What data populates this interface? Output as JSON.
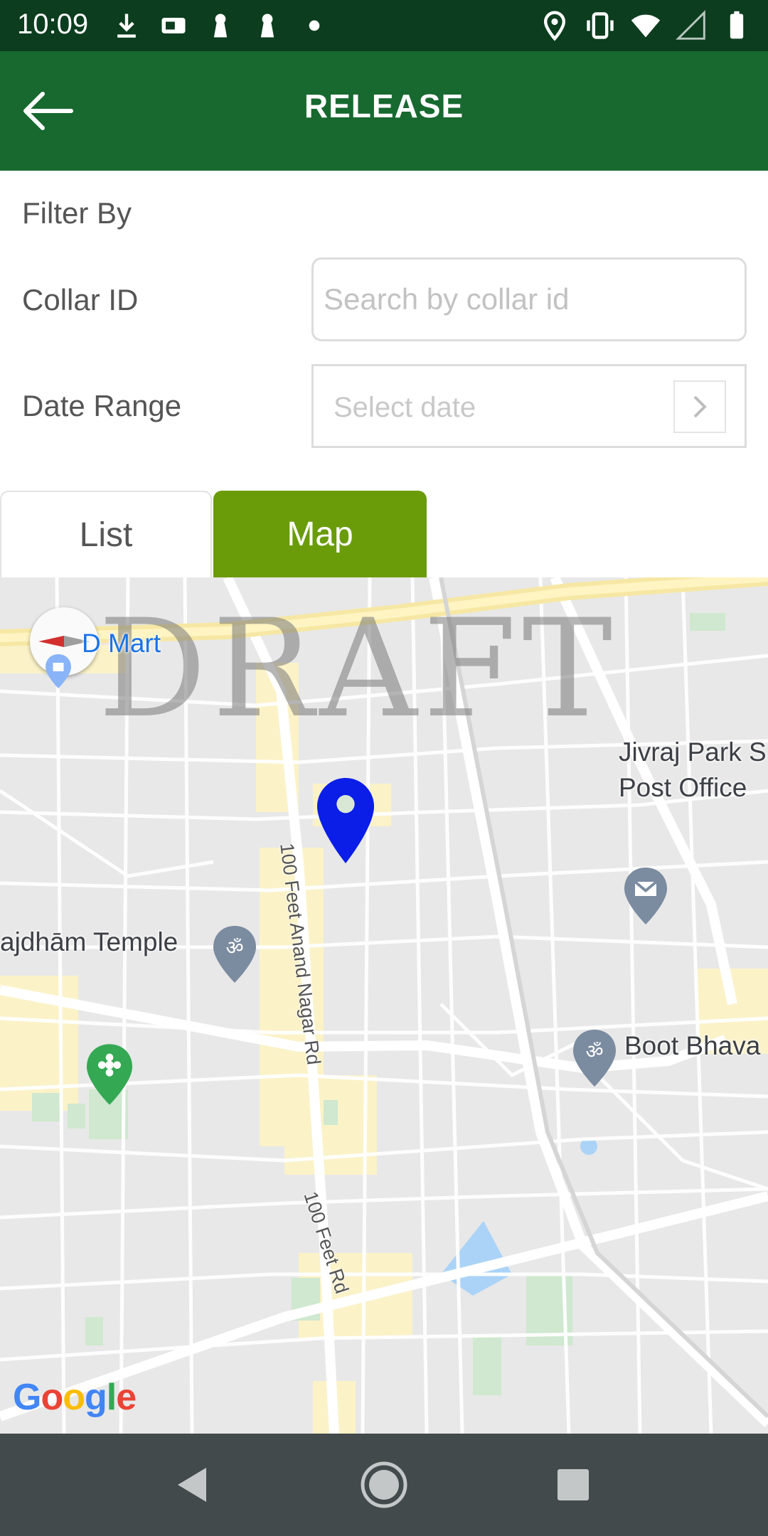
{
  "status_bar": {
    "time": "10:09",
    "left_icons": [
      "download-icon",
      "cast-icon",
      "keyhole-icon",
      "keyhole-icon",
      "dot-icon"
    ],
    "right_icons": [
      "location-icon",
      "vibrate-icon",
      "wifi-icon",
      "signal-icon",
      "battery-icon"
    ]
  },
  "app_bar": {
    "title": "RELEASE",
    "background": "#17692f",
    "back_icon": "arrow-back-icon"
  },
  "filter": {
    "title": "Filter By",
    "collar_label": "Collar ID",
    "collar_placeholder": "Search by collar id",
    "collar_value": "",
    "date_label": "Date Range",
    "date_placeholder": "Select date",
    "date_icon": "chevron-right-icon"
  },
  "tabs": [
    {
      "label": "List",
      "active": false
    },
    {
      "label": "Map",
      "active": true
    }
  ],
  "accent_color": "#6a9c0a",
  "map": {
    "watermark": "DRAFT",
    "labels": {
      "dmart": "D Mart",
      "jivraj": "Jivraj Park S",
      "post_office": "Post Office",
      "temple": "ajdhām Temple",
      "boot": "Boot Bhava",
      "road_anand": "100 Feet Anand Nagar Rd",
      "road_feet": "100 Feet Rd"
    },
    "pin_color": "#0a1ee8",
    "attribution": "Google"
  },
  "nav_bar": {
    "buttons": [
      "back-triangle-icon",
      "home-circle-icon",
      "recents-square-icon"
    ]
  }
}
